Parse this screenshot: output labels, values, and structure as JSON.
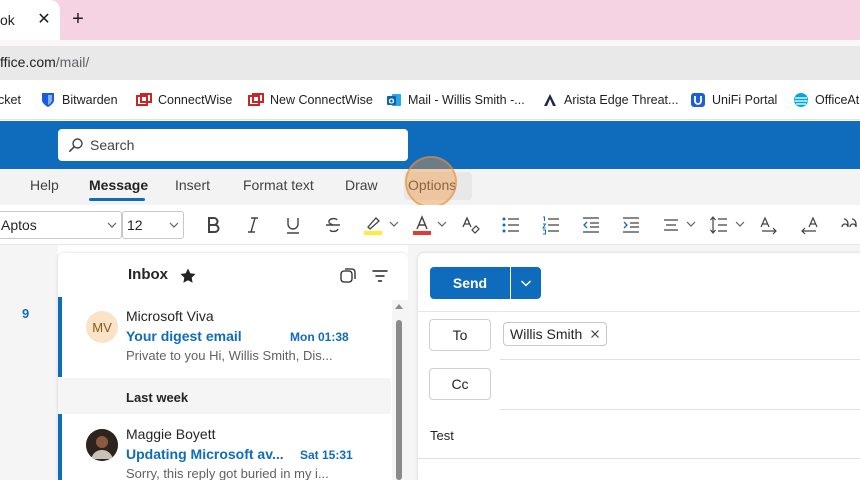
{
  "browser": {
    "tab_title": "ok",
    "url_host": "ffice.com",
    "url_path": "/mail/",
    "bookmarks": [
      {
        "label": "cket"
      },
      {
        "label": "Bitwarden"
      },
      {
        "label": "ConnectWise"
      },
      {
        "label": "New ConnectWise"
      },
      {
        "label": "Mail - Willis Smith -..."
      },
      {
        "label": "Arista Edge Threat..."
      },
      {
        "label": "UniFi Portal"
      },
      {
        "label": "OfficeAtl"
      }
    ]
  },
  "header": {
    "search_placeholder": "Search"
  },
  "ribbon": {
    "tabs": [
      {
        "label": "Help"
      },
      {
        "label": "Message"
      },
      {
        "label": "Insert"
      },
      {
        "label": "Format text"
      },
      {
        "label": "Draw"
      },
      {
        "label": "Options"
      }
    ],
    "active_tab": "Message",
    "font_name": "Aptos",
    "font_size": "12"
  },
  "rail": {
    "count": "9"
  },
  "mail_list": {
    "folder_title": "Inbox",
    "group_label": "Last week",
    "items": [
      {
        "avatar_initials": "MV",
        "sender": "Microsoft Viva",
        "subject": "Your digest email",
        "time": "Mon 01:38",
        "preview": "Private to you Hi, Willis Smith, Dis..."
      },
      {
        "avatar_initials": "",
        "sender": "Maggie Boyett",
        "subject": "Updating Microsoft av...",
        "time": "Sat 15:31",
        "preview": "Sorry, this reply got buried in my i..."
      }
    ]
  },
  "compose": {
    "send_label": "Send",
    "to_label": "To",
    "cc_label": "Cc",
    "to_recipient": "Willis Smith",
    "subject_value": "Test"
  },
  "colors": {
    "brand_blue": "#0f6cbd",
    "tabstrip_pink": "#f5d3e3",
    "cursor_highlight": "#f0963c"
  }
}
